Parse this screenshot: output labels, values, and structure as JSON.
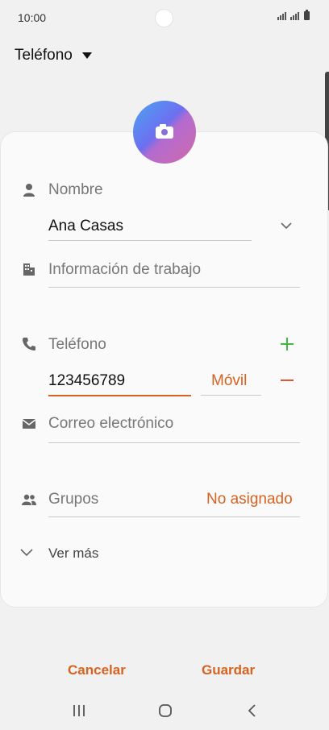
{
  "status_bar": {
    "time": "10:00"
  },
  "account": {
    "label": "Teléfono",
    "icon": "caret-down-icon"
  },
  "form": {
    "photo_icon": "camera-icon",
    "name": {
      "placeholder": "Nombre",
      "value": "Ana Casas",
      "icon": "person-icon"
    },
    "work": {
      "placeholder": "Información de trabajo",
      "icon": "building-icon"
    },
    "phone": {
      "placeholder": "Teléfono",
      "value": "123456789",
      "type": "Móvil",
      "icon": "phone-icon"
    },
    "email": {
      "placeholder": "Correo electrónico",
      "icon": "mail-icon"
    },
    "groups": {
      "label": "Grupos",
      "value": "No asignado",
      "icon": "group-icon"
    },
    "more": {
      "label": "Ver más"
    }
  },
  "actions": {
    "cancel": "Cancelar",
    "save": "Guardar"
  },
  "colors": {
    "accent": "#d8621f",
    "add": "#3fb93f",
    "background": "#f1f1f1"
  }
}
